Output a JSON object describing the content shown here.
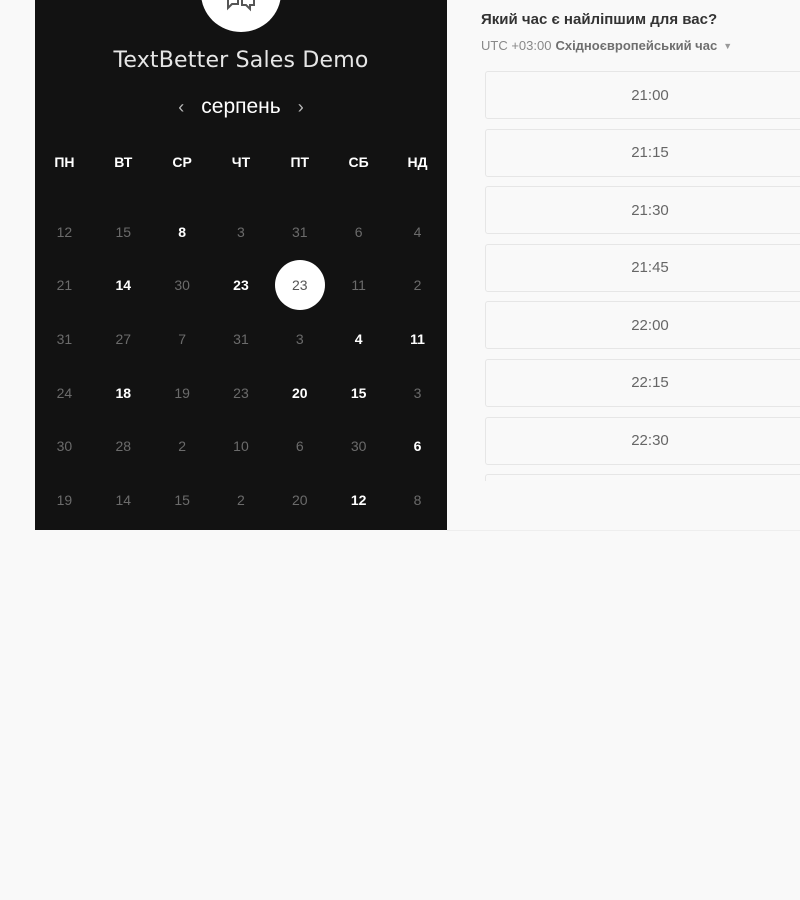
{
  "event": {
    "title": "TextBetter Sales Demo",
    "avatar_icon": "chat-bubble-icon"
  },
  "calendar": {
    "month": "серпень",
    "prev_icon": "‹",
    "next_icon": "›",
    "weekdays": [
      "ПН",
      "ВТ",
      "СР",
      "ЧТ",
      "ПТ",
      "СБ",
      "НД"
    ],
    "weeks": [
      [
        {
          "d": "12",
          "s": "off"
        },
        {
          "d": "15",
          "s": "off"
        },
        {
          "d": "8",
          "s": "on"
        },
        {
          "d": "3",
          "s": "off"
        },
        {
          "d": "31",
          "s": "off"
        },
        {
          "d": "6",
          "s": "off"
        },
        {
          "d": "4",
          "s": "off"
        }
      ],
      [
        {
          "d": "21",
          "s": "off"
        },
        {
          "d": "14",
          "s": "on"
        },
        {
          "d": "30",
          "s": "off"
        },
        {
          "d": "23",
          "s": "on"
        },
        {
          "d": "23",
          "s": "selected"
        },
        {
          "d": "11",
          "s": "off"
        },
        {
          "d": "2",
          "s": "off"
        }
      ],
      [
        {
          "d": "31",
          "s": "off"
        },
        {
          "d": "27",
          "s": "off"
        },
        {
          "d": "7",
          "s": "off"
        },
        {
          "d": "31",
          "s": "off"
        },
        {
          "d": "3",
          "s": "off"
        },
        {
          "d": "4",
          "s": "on"
        },
        {
          "d": "11",
          "s": "on"
        }
      ],
      [
        {
          "d": "24",
          "s": "off"
        },
        {
          "d": "18",
          "s": "on"
        },
        {
          "d": "19",
          "s": "off"
        },
        {
          "d": "23",
          "s": "off"
        },
        {
          "d": "20",
          "s": "on"
        },
        {
          "d": "15",
          "s": "on"
        },
        {
          "d": "3",
          "s": "off"
        }
      ],
      [
        {
          "d": "30",
          "s": "off"
        },
        {
          "d": "28",
          "s": "off"
        },
        {
          "d": "2",
          "s": "off"
        },
        {
          "d": "10",
          "s": "off"
        },
        {
          "d": "6",
          "s": "off"
        },
        {
          "d": "30",
          "s": "off"
        },
        {
          "d": "6",
          "s": "on"
        }
      ],
      [
        {
          "d": "19",
          "s": "off"
        },
        {
          "d": "14",
          "s": "off"
        },
        {
          "d": "15",
          "s": "off"
        },
        {
          "d": "2",
          "s": "off"
        },
        {
          "d": "20",
          "s": "off"
        },
        {
          "d": "12",
          "s": "on"
        },
        {
          "d": "8",
          "s": "off"
        }
      ]
    ]
  },
  "scheduler": {
    "question": "Який час є найліпшим для вас?",
    "tz_offset": "UTC +03:00",
    "tz_name": "Східноєвропейський час",
    "tz_caret": "▼",
    "slots": [
      "21:00",
      "21:15",
      "21:30",
      "21:45",
      "22:00",
      "22:15",
      "22:30",
      ""
    ]
  }
}
